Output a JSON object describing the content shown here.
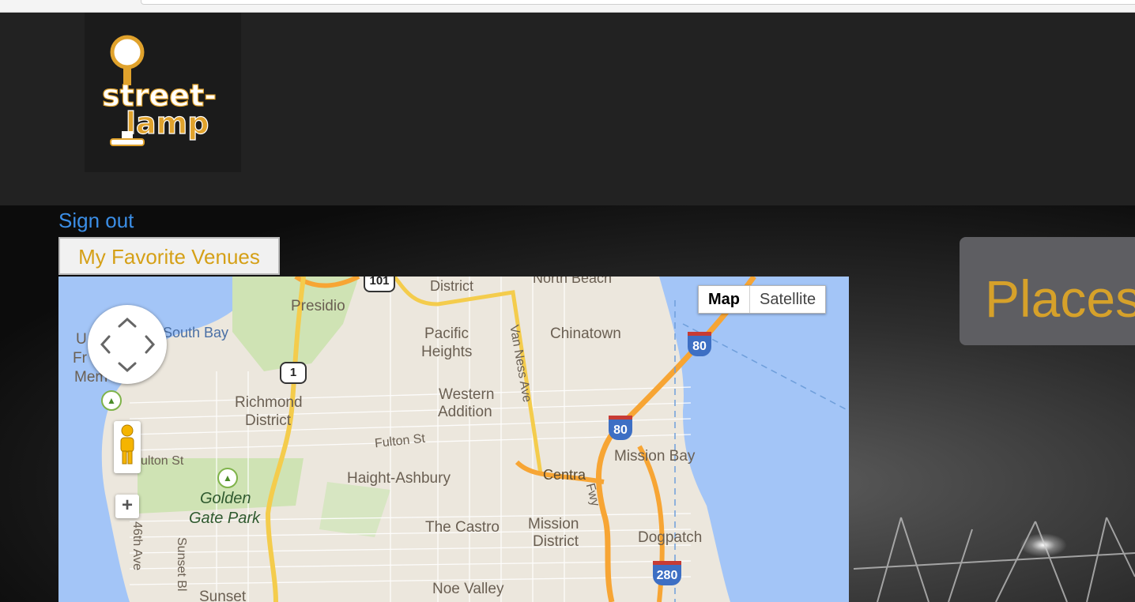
{
  "nav": {
    "sign_out": "Sign out",
    "favorites_button": "My Favorite Venues"
  },
  "places": {
    "title": "Places"
  },
  "map": {
    "type_controls": {
      "map": "Map",
      "satellite": "Satellite"
    },
    "labels": {
      "district": "District",
      "north_beach": "North Beach",
      "presidio": "Presidio",
      "south_bay": "South Bay",
      "pacific_heights_1": "Pacific",
      "pacific_heights_2": "Heights",
      "van_ness": "Van Ness Ave",
      "chinatown": "Chinatown",
      "richmond_1": "Richmond",
      "richmond_2": "District",
      "western_1": "Western",
      "western_2": "Addition",
      "fulton_1": "Fulton St",
      "fulton_2": "ulton St",
      "haight": "Haight-Ashbury",
      "central_fwy_1": "Centra",
      "central_fwy_2": "Fwy",
      "mission_bay": "Mission Bay",
      "golden_gate_1": "Golden",
      "golden_gate_2": "Gate Park",
      "castro": "The Castro",
      "mission_1": "Mission",
      "mission_2": "District",
      "dogpatch": "Dogpatch",
      "noe_valley": "Noe Valley",
      "ave_46": "46th Ave",
      "sunset_blvd": "Sunset Bl",
      "sunset": "Sunset",
      "frag_u": "U",
      "frag_fr": "Fr",
      "frag_mem": "Mem"
    },
    "shields": {
      "i80_a": "80",
      "i80_b": "80",
      "i280": "280",
      "us101": "101",
      "ca1": "1"
    }
  }
}
